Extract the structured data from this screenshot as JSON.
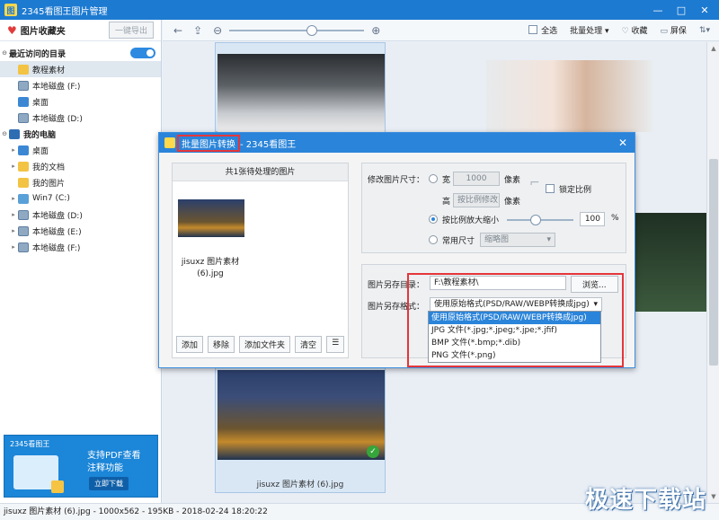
{
  "window": {
    "title": "2345看图王图片管理",
    "controls": [
      "—",
      "□",
      "✕"
    ]
  },
  "sidebar": {
    "favorites_label": "图片收藏夹",
    "export_label": "一键导出",
    "recent_label": "最近访问的目录",
    "recent_items": [
      "教程素材",
      "本地磁盘 (F:)",
      "桌面",
      "本地磁盘 (D:)"
    ],
    "pc_label": "我的电脑",
    "pc_items": [
      "桌面",
      "我的文档",
      "我的图片",
      "Win7 (C:)",
      "本地磁盘 (D:)",
      "本地磁盘 (E:)",
      "本地磁盘 (F:)"
    ]
  },
  "banner": {
    "brand": "2345看图王",
    "line1": "支持PDF查看",
    "line2": "注释功能",
    "button": "立即下载"
  },
  "toolbar": {
    "select_all": "全选",
    "batch": "批量处理",
    "favorite": "收藏",
    "screen": "屏保"
  },
  "thumbnails": {
    "selected_caption": "jisuxz 图片素材 (6).jpg"
  },
  "dialog": {
    "title_highlight": "批量图片转换",
    "title_rest": " - 2345看图王",
    "left_header": "共1张待处理的图片",
    "file_caption_line1": "jisuxz 图片素材",
    "file_caption_line2": "(6).jpg",
    "buttons": [
      "添加",
      "移除",
      "添加文件夹",
      "清空"
    ],
    "resize_label": "修改图片尺寸：",
    "width_label": "宽",
    "width_value": "1000",
    "height_label": "高",
    "height_placeholder": "按比例修改",
    "unit": "像素",
    "lock_label": "锁定比例",
    "scale_label": "按比例放大缩小",
    "scale_value": "100",
    "percent": "%",
    "common_label": "常用尺寸",
    "common_value": "缩略图",
    "save_dir_label": "图片另存目录：",
    "save_dir_value": "F:\\教程素材\\",
    "browse": "浏览...",
    "save_format_label": "图片另存格式：",
    "save_format_value": "使用原始格式(PSD/RAW/WEBP转换成jpg)",
    "format_options": [
      "使用原始格式(PSD/RAW/WEBP转换成jpg)",
      "JPG 文件(*.jpg;*.jpeg;*.jpe;*.jfif)",
      "BMP 文件(*.bmp;*.dib)",
      "PNG 文件(*.png)"
    ]
  },
  "status": {
    "text": "jisuxz 图片素材 (6).jpg - 1000x562 - 195KB - 2018-02-24 18:20:22"
  },
  "watermark": "极速下载站"
}
